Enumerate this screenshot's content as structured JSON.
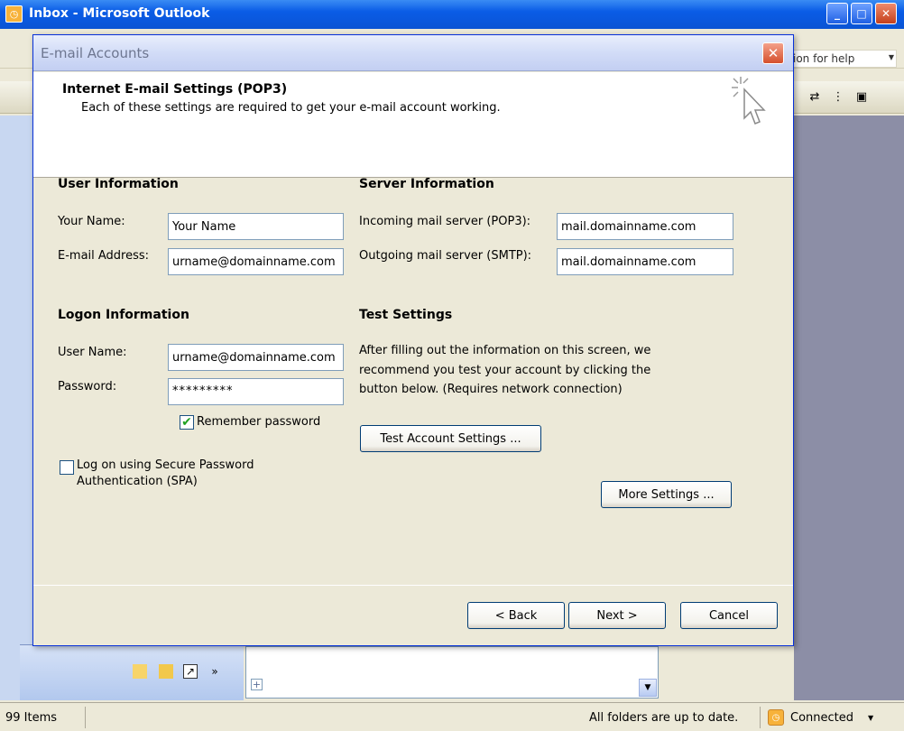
{
  "outlook": {
    "title": "Inbox - Microsoft Outlook",
    "help_box": "ion for help",
    "status": {
      "items": "99 Items",
      "sync": "All folders are up to date.",
      "connection": "Connected"
    }
  },
  "dialog": {
    "title": "E-mail Accounts",
    "heading": "Internet E-mail Settings (POP3)",
    "subheading": "Each of these settings are required to get your e-mail account working.",
    "user_info": {
      "title": "User Information",
      "name_label": "Your Name:",
      "name_value": "Your Name",
      "email_label": "E-mail Address:",
      "email_value": "urname@domainname.com"
    },
    "server_info": {
      "title": "Server Information",
      "incoming_label": "Incoming mail server (POP3):",
      "incoming_value": "mail.domainname.com",
      "outgoing_label": "Outgoing mail server (SMTP):",
      "outgoing_value": "mail.domainname.com"
    },
    "logon_info": {
      "title": "Logon Information",
      "username_label": "User Name:",
      "username_value": "urname@domainname.com",
      "password_label": "Password:",
      "password_value": "*********",
      "remember_label": "Remember password",
      "remember_checked": true,
      "spa_label_1": "Log on using Secure Password",
      "spa_label_2": "Authentication (SPA)",
      "spa_checked": false
    },
    "test_settings": {
      "title": "Test Settings",
      "line1": "After filling out the information on this screen, we",
      "line2": "recommend you test your account by clicking the",
      "line3": "button below. (Requires network connection)",
      "test_button": "Test Account Settings ..."
    },
    "more_settings_button": "More Settings ...",
    "back_button": "< Back",
    "next_button": "Next >",
    "cancel_button": "Cancel"
  }
}
